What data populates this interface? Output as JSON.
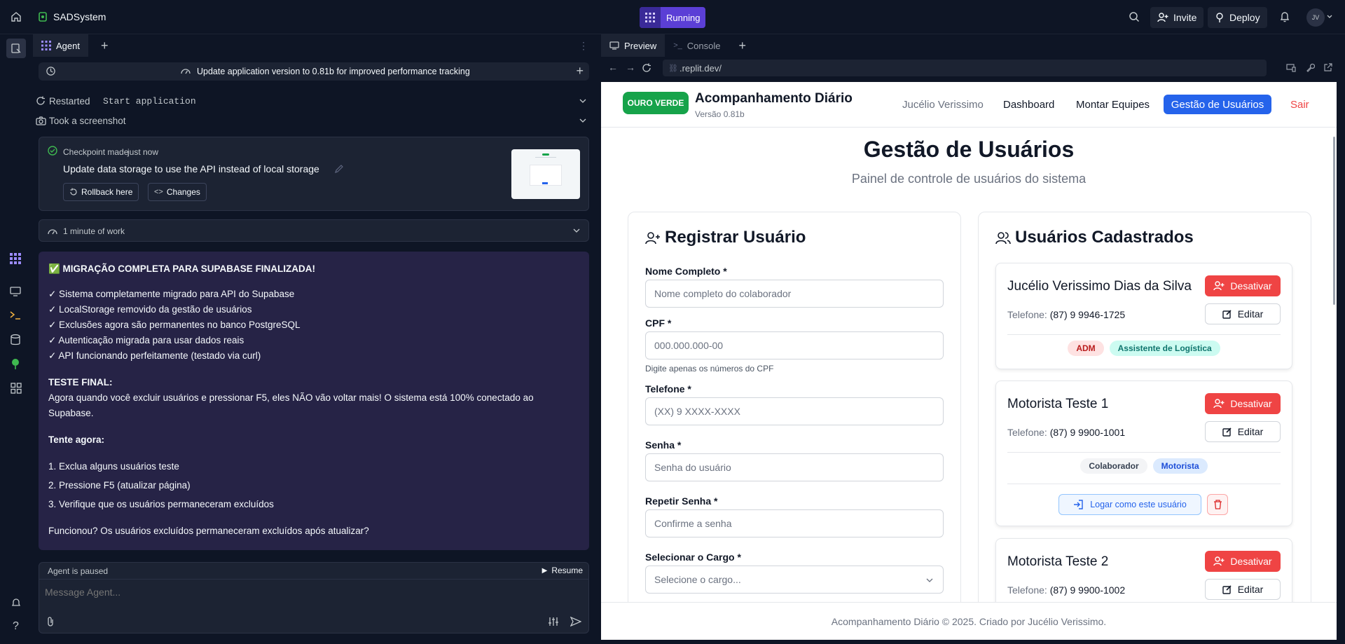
{
  "topbar": {
    "app_name": "SADSystem",
    "run_status": "Running",
    "invite_label": "Invite",
    "deploy_label": "Deploy",
    "avatar_initials": "JV"
  },
  "agent": {
    "tab_label": "Agent",
    "history_title": "Update application version to 0.81b for improved performance tracking",
    "action_restarted_prefix": "Restarted",
    "action_restarted_target": "Start application",
    "action_screenshot": "Took a screenshot",
    "checkpoint": {
      "prefix": "Checkpoint made",
      "time": "just now",
      "title": "Update data storage to use the API instead of local storage",
      "rollback_label": "Rollback here",
      "changes_label": "Changes"
    },
    "work_label": "1 minute of work",
    "message": {
      "heading": "✅ MIGRAÇÃO COMPLETA PARA SUPABASE FINALIZADA!",
      "checks": [
        "✓ Sistema completamente migrado para API do Supabase",
        "✓ LocalStorage removido da gestão de usuários",
        "✓ Exclusões agora são permanentes no banco PostgreSQL",
        "✓ Autenticação migrada para usar dados reais",
        "✓ API funcionando perfeitamente (testado via curl)"
      ],
      "final_title": "TESTE FINAL:",
      "final_text": "Agora quando você excluir usuários e pressionar F5, eles NÃO vão voltar mais! O sistema está 100% conectado ao Supabase.",
      "try_title": "Tente agora:",
      "steps": [
        "1. Exclua alguns usuários teste",
        "2. Pressione F5 (atualizar página)",
        "3. Verifique que os usuários permaneceram excluídos"
      ],
      "question": "Funcionou? Os usuários excluídos permaneceram excluídos após atualizar?"
    },
    "paused_label": "Agent is paused",
    "resume_label": "Resume",
    "input_placeholder": "Message Agent..."
  },
  "preview": {
    "tab_preview": "Preview",
    "tab_console": "Console",
    "url": ".replit.dev/"
  },
  "site": {
    "logo_text": "OURO VERDE",
    "title": "Acompanhamento Diário",
    "version": "Versão 0.81b",
    "nav": {
      "user": "Jucélio Verissimo",
      "dashboard": "Dashboard",
      "teams": "Montar Equipes",
      "users": "Gestão de Usuários",
      "logout": "Sair"
    },
    "page_title": "Gestão de Usuários",
    "page_subtitle": "Painel de controle de usuários do sistema",
    "form": {
      "title": "Registrar Usuário",
      "name_label": "Nome Completo *",
      "name_placeholder": "Nome completo do colaborador",
      "cpf_label": "CPF *",
      "cpf_placeholder": "000.000.000-00",
      "cpf_hint": "Digite apenas os números do CPF",
      "phone_label": "Telefone *",
      "phone_placeholder": "(XX) 9 XXXX-XXXX",
      "pass_label": "Senha *",
      "pass_placeholder": "Senha do usuário",
      "repeat_label": "Repetir Senha *",
      "repeat_placeholder": "Confirme a senha",
      "role_label": "Selecionar o Cargo *",
      "role_placeholder": "Selecione o cargo..."
    },
    "list": {
      "title": "Usuários Cadastrados",
      "deactivate_label": "Desativar",
      "edit_label": "Editar",
      "phone_prefix": "Telefone:",
      "login_as_label": "Logar como este usuário",
      "users": [
        {
          "name": "Jucélio Verissimo Dias da Silva",
          "phone": "(87) 9 9946-1725",
          "role": "ADM",
          "job": "Assistente de Logística"
        },
        {
          "name": "Motorista Teste 1",
          "phone": "(87) 9 9900-1001",
          "role": "Colaborador",
          "job": "Motorista"
        },
        {
          "name": "Motorista Teste 2",
          "phone": "(87) 9 9900-1002"
        }
      ]
    },
    "footer": "Acompanhamento Diário © 2025. Criado por Jucélio Verissimo."
  }
}
